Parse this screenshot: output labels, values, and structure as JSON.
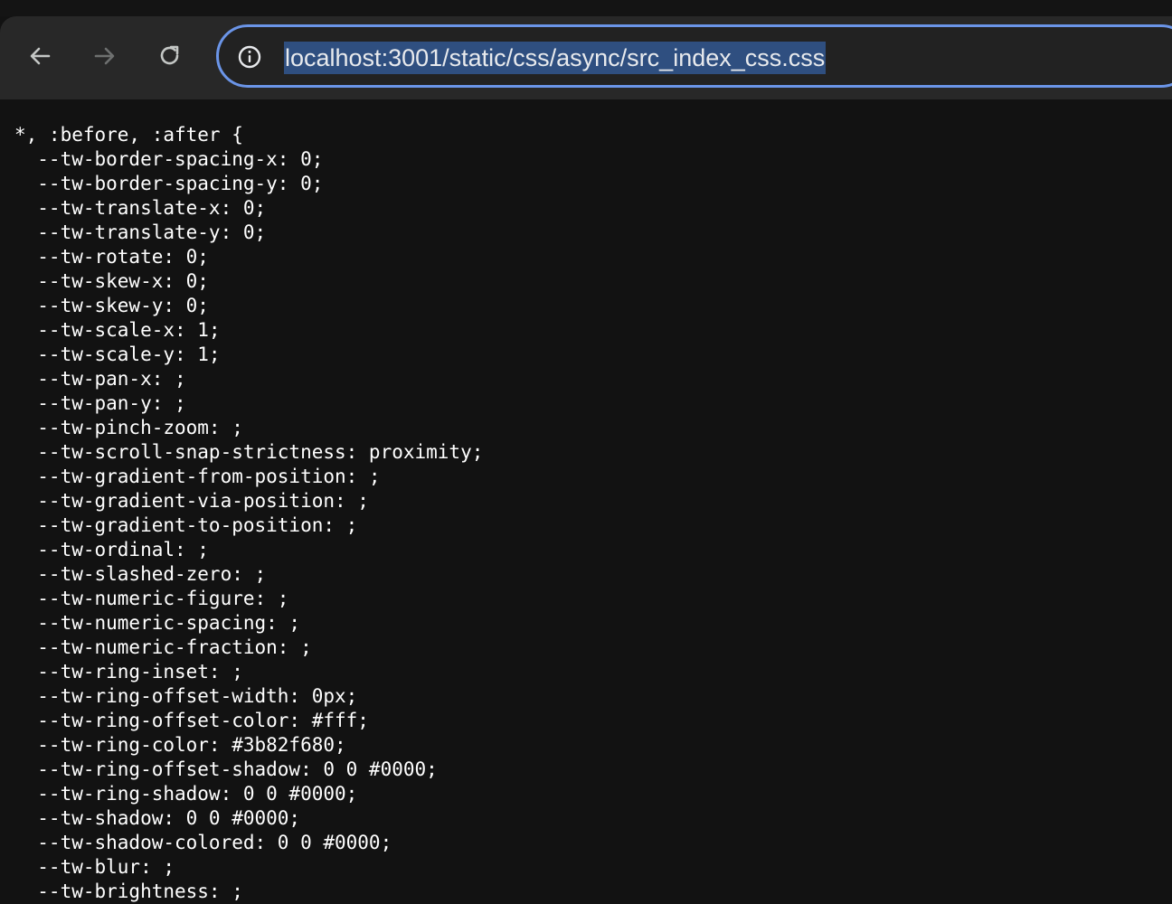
{
  "browser": {
    "url": "localhost:3001/static/css/async/src_index_css.css",
    "back_icon": "arrow-left",
    "forward_icon": "arrow-right",
    "reload_icon": "reload",
    "site_info_icon": "info-circle",
    "accent_color": "#6b95e8",
    "selection_color": "#2f4f80"
  },
  "stylesheet": {
    "lines": [
      "*, :before, :after {",
      "  --tw-border-spacing-x: 0;",
      "  --tw-border-spacing-y: 0;",
      "  --tw-translate-x: 0;",
      "  --tw-translate-y: 0;",
      "  --tw-rotate: 0;",
      "  --tw-skew-x: 0;",
      "  --tw-skew-y: 0;",
      "  --tw-scale-x: 1;",
      "  --tw-scale-y: 1;",
      "  --tw-pan-x: ;",
      "  --tw-pan-y: ;",
      "  --tw-pinch-zoom: ;",
      "  --tw-scroll-snap-strictness: proximity;",
      "  --tw-gradient-from-position: ;",
      "  --tw-gradient-via-position: ;",
      "  --tw-gradient-to-position: ;",
      "  --tw-ordinal: ;",
      "  --tw-slashed-zero: ;",
      "  --tw-numeric-figure: ;",
      "  --tw-numeric-spacing: ;",
      "  --tw-numeric-fraction: ;",
      "  --tw-ring-inset: ;",
      "  --tw-ring-offset-width: 0px;",
      "  --tw-ring-offset-color: #fff;",
      "  --tw-ring-color: #3b82f680;",
      "  --tw-ring-offset-shadow: 0 0 #0000;",
      "  --tw-ring-shadow: 0 0 #0000;",
      "  --tw-shadow: 0 0 #0000;",
      "  --tw-shadow-colored: 0 0 #0000;",
      "  --tw-blur: ;",
      "  --tw-brightness: ;"
    ]
  }
}
